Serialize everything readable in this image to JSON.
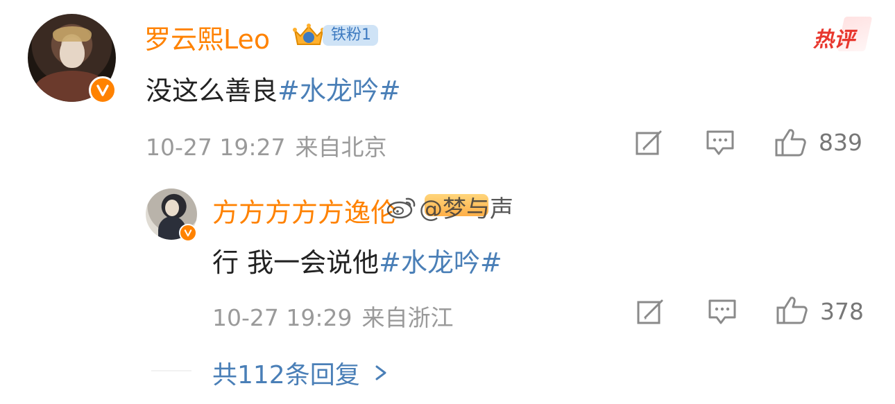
{
  "comment": {
    "username": "罗云熙Leo",
    "fan_badge": "铁粉1",
    "hot_label": "热评",
    "text": "没这么善良",
    "hashtag": "#水龙吟#",
    "time": "10-27 19:27",
    "source": "来自北京",
    "likes": "839"
  },
  "reply": {
    "username": "方方方方方逸伦",
    "text": "行 我一会说他",
    "hashtag": "#水龙吟#",
    "time": "10-27 19:29",
    "source": "来自浙江",
    "likes": "378"
  },
  "watermark": {
    "text": "@梦与声"
  },
  "more_replies": {
    "label": "共112条回复"
  },
  "colors": {
    "username": "#ff8200",
    "hashtag": "#4a7fb7",
    "meta": "#9a9a9a",
    "hot": "#e8372e",
    "fan_badge_bg": "#cfe3f6"
  },
  "icons": {
    "verified": "verified-v-icon",
    "share": "share-edit-icon",
    "comment": "comment-bubble-icon",
    "like": "thumbs-up-icon",
    "fan_crown": "crown-icon",
    "chevron": "chevron-right-icon",
    "weibo": "weibo-logo-icon"
  }
}
